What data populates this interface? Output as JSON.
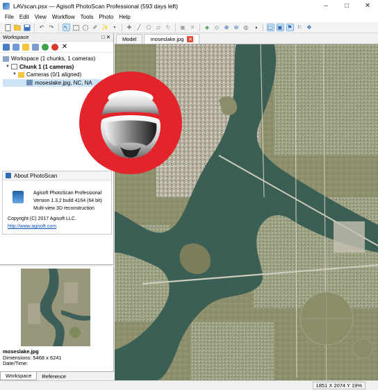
{
  "window": {
    "title": "LAVscan.psx — Agisoft PhotoScan Professional (593 days left)"
  },
  "menu": [
    "File",
    "Edit",
    "View",
    "Workflow",
    "Tools",
    "Photo",
    "Help"
  ],
  "workspace": {
    "header": "Workspace",
    "tree": {
      "root": "Workspace (1 chunks, 1 cameras)",
      "chunk": "Chunk 1 (1 cameras)",
      "cameras": "Cameras (0/1 aligned)",
      "camera": "moseslake.jpg, NC, NA"
    }
  },
  "about": {
    "title": "About PhotoScan",
    "product": "Agisoft PhotoScan Professional",
    "version": "Version 1.3.2 build 4164 (64 bit)",
    "desc": "Multi-view 3D reconstruction",
    "copyright": "Copyright (C) 2017 Agisoft LLC.",
    "link": "http://www.agisoft.com"
  },
  "photo": {
    "name": "moseslake.jpg",
    "dimensions": "Dimensions: 5468 x 6241",
    "datetime": "Date/Time:"
  },
  "bottom_tabs": [
    "Workspace",
    "Reference"
  ],
  "view_tabs": [
    "Model",
    "moseslake.jpg"
  ],
  "status": "1851 X  2074 Y  19%",
  "colors": {
    "selection": "#cde4f7",
    "link": "#0a4fb5",
    "logo_red": "#e3242b"
  }
}
